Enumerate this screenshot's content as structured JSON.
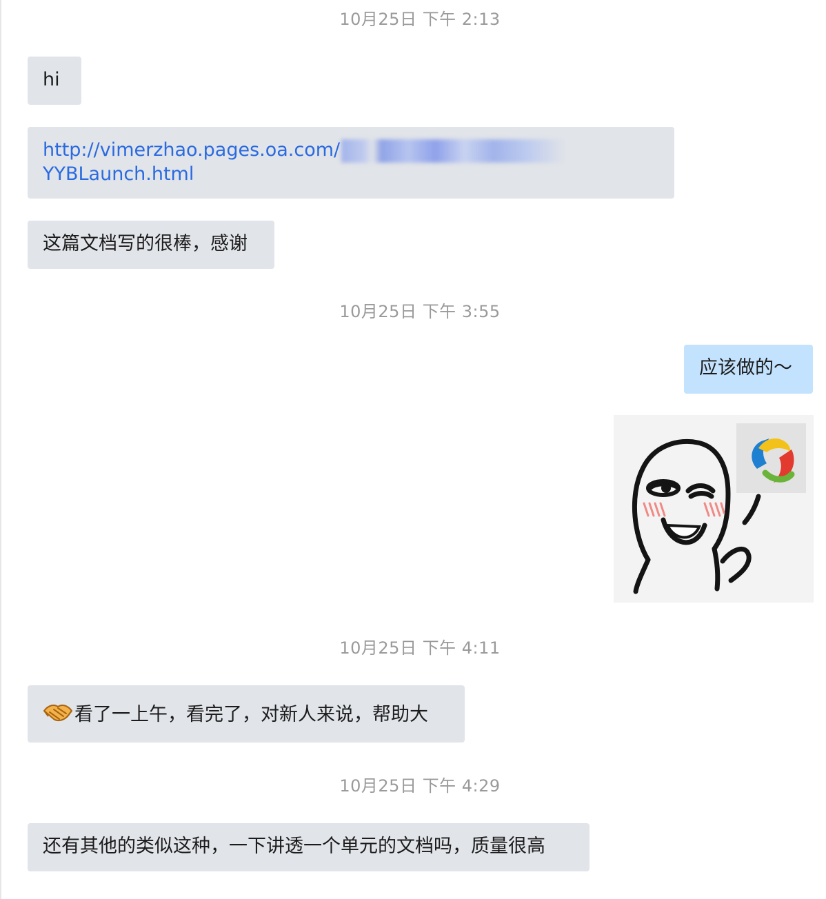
{
  "messages": {
    "ts1": "10月25日 下午 2:13",
    "msg_hi": "hi",
    "link_line1": "http://vimerzhao.pages.oa.com/",
    "link_line2": "YYBLaunch.html",
    "msg_thanks": "这篇文档写的很棒，感谢",
    "ts2": "10月25日 下午 3:55",
    "reply": "应该做的～",
    "ts3": "10月25日 下午 4:11",
    "msg_read": "看了一上午，看完了，对新人来说，帮助大",
    "ts4": "10月25日 下午 4:29",
    "msg_more": "还有其他的类似这种，一下讲透一个单元的文档吗，质量很高"
  },
  "colors": {
    "bubble_received": "#e1e4e9",
    "bubble_sent": "#c2e2fd",
    "link": "#2a6ae0",
    "timestamp": "#9a9a9a"
  },
  "icons": {
    "sticker": "winking-face-sticker",
    "badge": "yingyongbao-logo-icon",
    "handshake": "handshake-icon"
  }
}
